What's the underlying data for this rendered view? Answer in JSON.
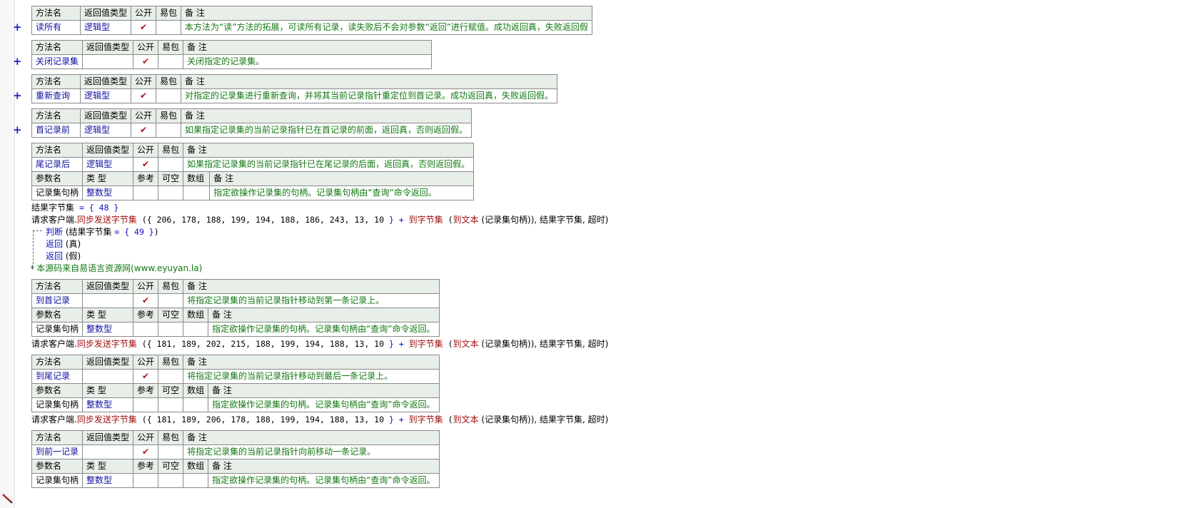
{
  "headers": {
    "method": [
      "方法名",
      "返回值类型",
      "公开",
      "易包",
      "备 注"
    ],
    "param": [
      "参数名",
      "类 型",
      "参考",
      "可空",
      "数组",
      "备 注"
    ]
  },
  "check": "✔",
  "expand": "+",
  "methods": [
    {
      "name": "读所有",
      "ret": "逻辑型",
      "note": "本方法为“读”方法的拓展，可读所有记录，读失败后不会对参数“返回”进行赋值。成功返回真，失败返回假"
    },
    {
      "name": "关闭记录集",
      "ret": "",
      "note": "关闭指定的记录集。"
    },
    {
      "name": "重新查询",
      "ret": "逻辑型",
      "note": "对指定的记录集进行重新查询，并将其当前记录指针重定位到首记录。成功返回真，失败返回假。"
    },
    {
      "name": "首记录前",
      "ret": "逻辑型",
      "note": "如果指定记录集的当前记录指针已在首记录的前面，返回真，否则返回假。"
    },
    {
      "name": "尾记录后",
      "ret": "逻辑型",
      "note": "如果指定记录集的当前记录指针已在尾记录的后面，返回真，否则返回假。",
      "param": {
        "name": "记录集句柄",
        "type": "整数型",
        "note": "指定欲操作记录集的句柄。记录集句柄由“查询”命令返回。"
      }
    },
    {
      "name": "到首记录",
      "ret": "",
      "note": "将指定记录集的当前记录指针移动到第一条记录上。",
      "param": {
        "name": "记录集句柄",
        "type": "整数型",
        "note": "指定欲操作记录集的句柄。记录集句柄由“查询”命令返回。"
      }
    },
    {
      "name": "到尾记录",
      "ret": "",
      "note": "将指定记录集的当前记录指针移动到最后一条记录上。",
      "param": {
        "name": "记录集句柄",
        "type": "整数型",
        "note": "指定欲操作记录集的句柄。记录集句柄由“查询”命令返回。"
      }
    },
    {
      "name": "到前一记录",
      "ret": "",
      "note": "将指定记录集的当前记录指针向前移动一条记录。",
      "param": {
        "name": "记录集句柄",
        "type": "整数型",
        "note": "指定欲操作记录集的句柄。记录集句柄由“查询”命令返回。"
      }
    }
  ],
  "code1": {
    "assign": {
      "var": "结果字节集",
      "op": " = ",
      "val": "{ 48 }"
    },
    "call": {
      "obj": "请求客户端.",
      "fn": "同步发送字节集",
      "open": " ({ ",
      "nums": "206, 178, 188, 199, 194, 188, 186, 243, 13, 10",
      "close": " } + ",
      "fn2": "到字节集",
      "p1": " (",
      "fn3": "到文本",
      "p2": " (记录集句柄)), 结果字节集, 超时)"
    },
    "judge": {
      "kw": "判断",
      "open": " (结果字节集 ",
      "op": "= ",
      "val": "{ 49 }",
      "close": ")"
    },
    "ret_true": {
      "kw": "返回",
      "arg": " (真)"
    },
    "ret_false": {
      "kw": "返回",
      "arg": " (假)"
    },
    "comment": "' 本源码来自易语言资源网(www.eyuyan.la)"
  },
  "code2": {
    "obj": "请求客户端.",
    "fn": "同步发送字节集",
    "open": " ({ ",
    "nums": "181, 189, 202, 215, 188, 199, 194, 188, 13, 10",
    "close": " } + ",
    "fn2": "到字节集",
    "p1": " (",
    "fn3": "到文本",
    "p2": " (记录集句柄)), 结果字节集, 超时)"
  },
  "code3": {
    "obj": "请求客户端.",
    "fn": "同步发送字节集",
    "open": " ({ ",
    "nums": "181, 189, 206, 178, 188, 199, 194, 188, 13, 10",
    "close": " } + ",
    "fn2": "到字节集",
    "p1": " (",
    "fn3": "到文本",
    "p2": " (记录集句柄)), 结果字节集, 超时)"
  }
}
